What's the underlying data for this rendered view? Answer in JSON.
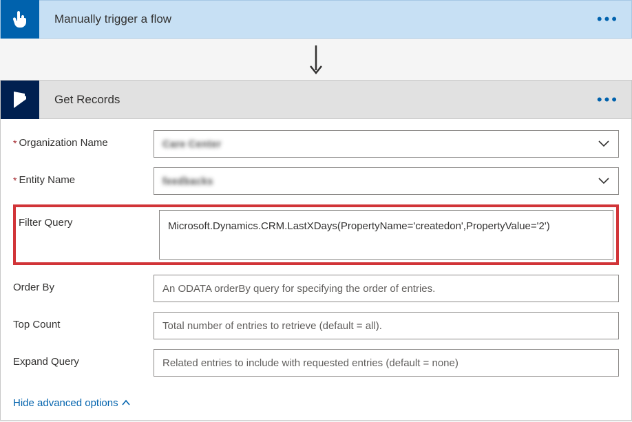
{
  "trigger": {
    "title": "Manually trigger a flow"
  },
  "action": {
    "title": "Get Records",
    "fields": {
      "org_name": {
        "label": "Organization Name",
        "required": true,
        "value": "Care Center"
      },
      "entity_name": {
        "label": "Entity Name",
        "required": true,
        "value": "feedbacks"
      },
      "filter_query": {
        "label": "Filter Query",
        "required": false,
        "value": "Microsoft.Dynamics.CRM.LastXDays(PropertyName='createdon',PropertyValue='2')"
      },
      "order_by": {
        "label": "Order By",
        "required": false,
        "placeholder": "An ODATA orderBy query for specifying the order of entries."
      },
      "top_count": {
        "label": "Top Count",
        "required": false,
        "placeholder": "Total number of entries to retrieve (default = all)."
      },
      "expand_query": {
        "label": "Expand Query",
        "required": false,
        "placeholder": "Related entries to include with requested entries (default = none)"
      }
    },
    "hide_advanced_label": "Hide advanced options"
  }
}
